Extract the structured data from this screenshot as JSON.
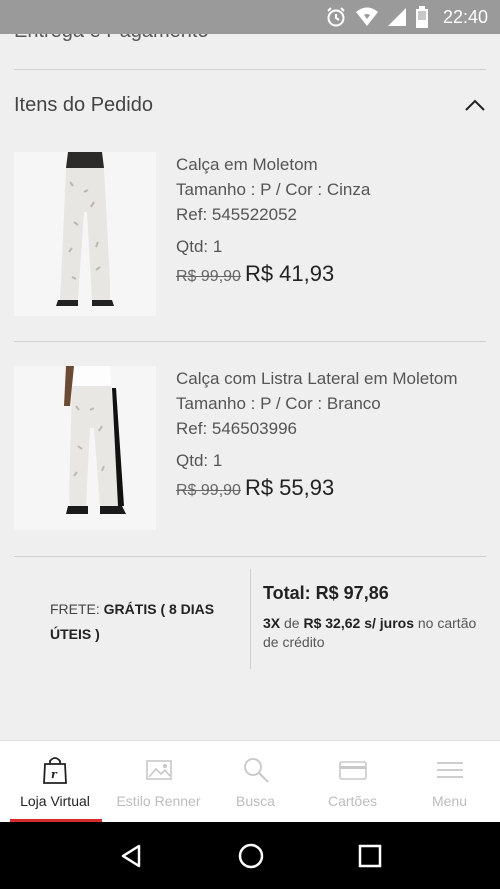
{
  "status_bar": {
    "time": "22:40",
    "icons": [
      "alarm-icon",
      "wifi-icon",
      "signal-icon",
      "battery-icon"
    ]
  },
  "partial_section_title": "Entrega e Pagamento",
  "order_items": {
    "title": "Itens do Pedido",
    "toggle_icon": "chevron-up-icon",
    "items": [
      {
        "name": "Calça em Moletom",
        "variant": "Tamanho : P / Cor : Cinza",
        "ref": "Ref: 545522052",
        "qty": "Qtd: 1",
        "old_price": "R$ 99,90",
        "price": "R$ 41,93"
      },
      {
        "name": "Calça com Listra Lateral em Moletom",
        "variant": "Tamanho : P / Cor : Branco",
        "ref": "Ref: 546503996",
        "qty": "Qtd: 1",
        "old_price": "R$ 99,90",
        "price": "R$ 55,93"
      }
    ]
  },
  "summary": {
    "frete_label": "FRETE:",
    "frete_value": "GRÁTIS ( 8 DIAS ÚTEIS )",
    "total": "Total: R$ 97,86",
    "installment_count": "3X",
    "installment_de": "de",
    "installment_value": "R$ 32,62 s/ juros",
    "installment_rest": "no cartão de crédito"
  },
  "tab_bar": {
    "active_color": "#d52b2b",
    "tabs": [
      {
        "label": "Loja Virtual",
        "icon": "shopping-bag-icon"
      },
      {
        "label": "Estilo Renner",
        "icon": "image-icon"
      },
      {
        "label": "Busca",
        "icon": "search-icon"
      },
      {
        "label": "Cartões",
        "icon": "card-icon"
      },
      {
        "label": "Menu",
        "icon": "menu-icon"
      }
    ]
  },
  "nav_bar": {
    "buttons": [
      "back-icon",
      "home-icon",
      "recents-icon"
    ]
  }
}
